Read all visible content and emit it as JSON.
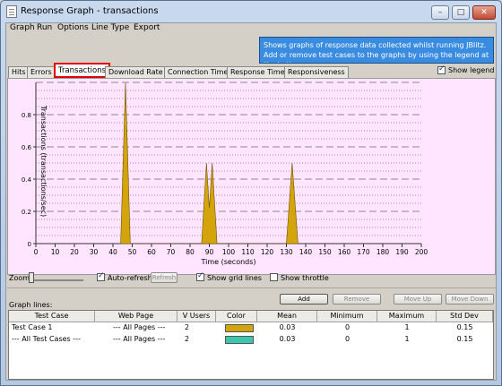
{
  "window": {
    "title": "Response Graph - transactions",
    "controls": {
      "minimize": "–",
      "maximize": "□",
      "close": "✕"
    }
  },
  "menu": [
    "Graph",
    "Run",
    "Options",
    "Line Type",
    "Export"
  ],
  "info_text": "Shows graphs of response data collected whilst running JBlitz. Add or remove test cases to the graphs by using the legend at the bottom",
  "tabs": [
    {
      "label": "Hits",
      "active": false
    },
    {
      "label": "Errors",
      "active": false
    },
    {
      "label": "Transactions",
      "active": true
    },
    {
      "label": "Download Rate",
      "active": false
    },
    {
      "label": "Connection Time",
      "active": false
    },
    {
      "label": "Response Time",
      "active": false
    },
    {
      "label": "Responsiveness",
      "active": false
    }
  ],
  "show_legend": {
    "label": "Show legend",
    "checked": true
  },
  "chart_data": {
    "type": "area",
    "xlabel": "Time (seconds)",
    "ylabel": "Transactions (transactions/sec)",
    "xlim": [
      0,
      200
    ],
    "ylim": [
      0,
      1
    ],
    "xticks": [
      "0",
      "10",
      "20",
      "30",
      "40",
      "50",
      "60",
      "70",
      "80",
      "90",
      "100",
      "110",
      "120",
      "130",
      "140",
      "150",
      "160",
      "170",
      "180",
      "190",
      "200"
    ],
    "yticks": [
      "0",
      "0.2",
      "0.4",
      "0.6",
      "0.8"
    ],
    "grid": true,
    "series": [
      {
        "name": "Test Case 1",
        "color": "#d4a40c",
        "points": [
          [
            44,
            0
          ],
          [
            46.5,
            1.0
          ],
          [
            49,
            0
          ],
          [
            86,
            0
          ],
          [
            88.5,
            0.5
          ],
          [
            90,
            0.22
          ],
          [
            91.5,
            0.5
          ],
          [
            94,
            0
          ],
          [
            130,
            0
          ],
          [
            133,
            0.5
          ],
          [
            136,
            0
          ]
        ]
      }
    ]
  },
  "controls": {
    "zoom_label": "Zoom",
    "auto_refresh": {
      "label": "Auto-refresh",
      "checked": true
    },
    "refresh_label": "Refresh",
    "show_grid": {
      "label": "Show grid lines",
      "checked": true
    },
    "show_throttle": {
      "label": "Show throttle",
      "checked": false
    }
  },
  "graph_lines": {
    "label": "Graph lines:",
    "buttons": {
      "add": "Add",
      "remove": "Remove",
      "move_up": "Move Up",
      "move_down": "Move Down"
    },
    "columns": [
      "Test Case",
      "Web Page",
      "V Users",
      "Color",
      "Mean",
      "Minimum",
      "Maximum",
      "Std Dev"
    ],
    "rows": [
      {
        "test_case": "Test Case 1",
        "web_page": "--- All Pages ---",
        "v_users": "2",
        "color": "#d4a40c",
        "mean": "0.03",
        "minimum": "0",
        "maximum": "1",
        "std_dev": "0.15"
      },
      {
        "test_case": "--- All Test Cases ---",
        "web_page": "--- All Pages ---",
        "v_users": "2",
        "color": "#3cc6ad",
        "mean": "0.03",
        "minimum": "0",
        "maximum": "1",
        "std_dev": "0.15"
      }
    ]
  }
}
